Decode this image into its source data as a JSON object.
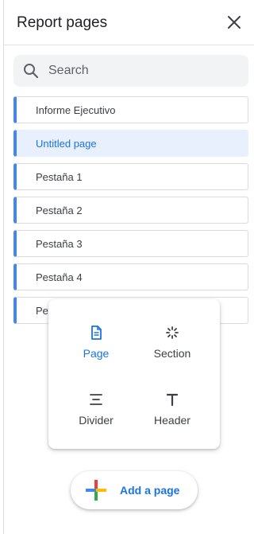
{
  "header": {
    "title": "Report pages"
  },
  "search": {
    "placeholder": "Search",
    "value": ""
  },
  "pages": [
    {
      "label": "Informe Ejecutivo",
      "active": false
    },
    {
      "label": "Untitled page",
      "active": true
    },
    {
      "label": "Pestaña 1",
      "active": false
    },
    {
      "label": "Pestaña 2",
      "active": false
    },
    {
      "label": "Pestaña 3",
      "active": false
    },
    {
      "label": "Pestaña 4",
      "active": false
    },
    {
      "label": "Pe",
      "active": false
    }
  ],
  "add_menu": {
    "page": "Page",
    "section": "Section",
    "divider": "Divider",
    "header": "Header"
  },
  "add_button": {
    "label": "Add a page"
  },
  "colors": {
    "accent": "#1a73e8",
    "page_marker": "#4285f4",
    "active_bg": "#e8f0fe"
  }
}
